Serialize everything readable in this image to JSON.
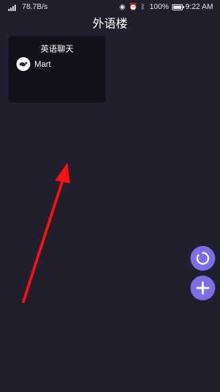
{
  "status_bar": {
    "network_speed": "78.7B/s",
    "battery_percent": "100%",
    "time": "9:22 AM",
    "icons": [
      "signal-icon",
      "eye-icon",
      "alarm-icon",
      "bluetooth-icon",
      "battery-icon"
    ]
  },
  "header": {
    "title": "外语楼"
  },
  "rooms": [
    {
      "name": "英语聊天",
      "members": [
        {
          "name": "Mart",
          "avatar": "avatar-icon"
        }
      ]
    }
  ],
  "fabs": {
    "refresh_icon": "refresh-icon",
    "add_icon": "plus-icon",
    "color": "#7b6ee6"
  },
  "annotation": {
    "arrow_color": "#ff1010"
  }
}
